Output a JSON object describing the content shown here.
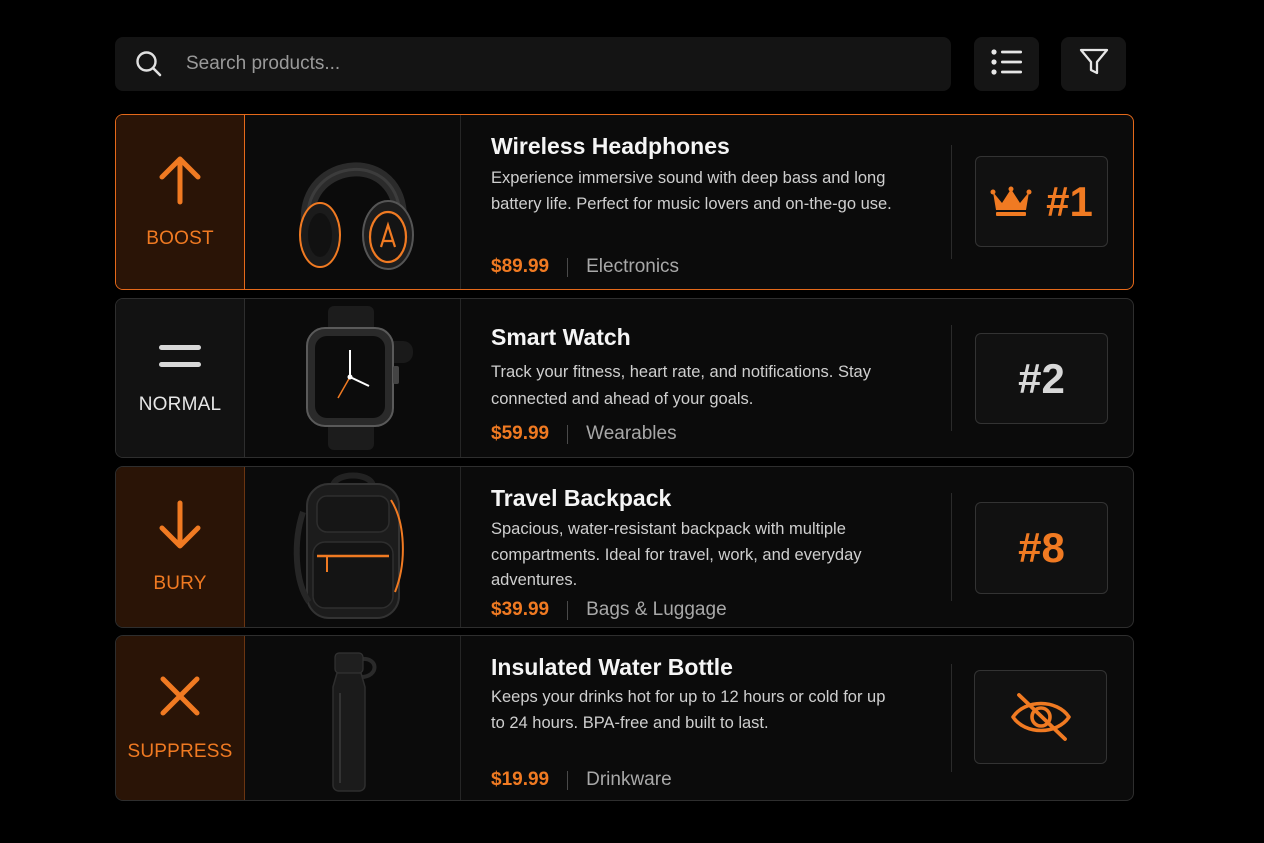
{
  "search": {
    "placeholder": "Search products..."
  },
  "toolbar": {
    "list_icon": "list-icon",
    "filter_icon": "filter-icon"
  },
  "colors": {
    "accent": "#f07a22",
    "background": "#000000",
    "row": "#0b0b0b"
  },
  "products": [
    {
      "action": "BOOST",
      "action_icon": "arrow-up-icon",
      "title": "Wireless Headphones",
      "description": "Experience immersive sound with deep bass and long battery life. Perfect for music lovers and on-the-go use.",
      "price": "$89.99",
      "category": "Electronics",
      "rank": "#1",
      "rank_icon": "crown-icon"
    },
    {
      "action": "NORMAL",
      "action_icon": "equals-icon",
      "title": "Smart Watch",
      "description": "Track your fitness, heart rate, and notifications. Stay connected and ahead of your goals.",
      "price": "$59.99",
      "category": "Wearables",
      "rank": "#2"
    },
    {
      "action": "BURY",
      "action_icon": "arrow-down-icon",
      "title": "Travel Backpack",
      "description": "Spacious, water-resistant backpack with multiple compartments. Ideal for travel, work, and everyday adventures.",
      "price": "$39.99",
      "category": "Bags & Luggage",
      "rank": "#8"
    },
    {
      "action": "SUPPRESS",
      "action_icon": "x-icon",
      "title": "Insulated Water Bottle",
      "description": "Keeps your drinks hot for up to 12 hours or cold for up to 24 hours. BPA-free and built to last.",
      "price": "$19.99",
      "category": "Drinkware",
      "rank_icon": "eye-off-icon"
    }
  ]
}
